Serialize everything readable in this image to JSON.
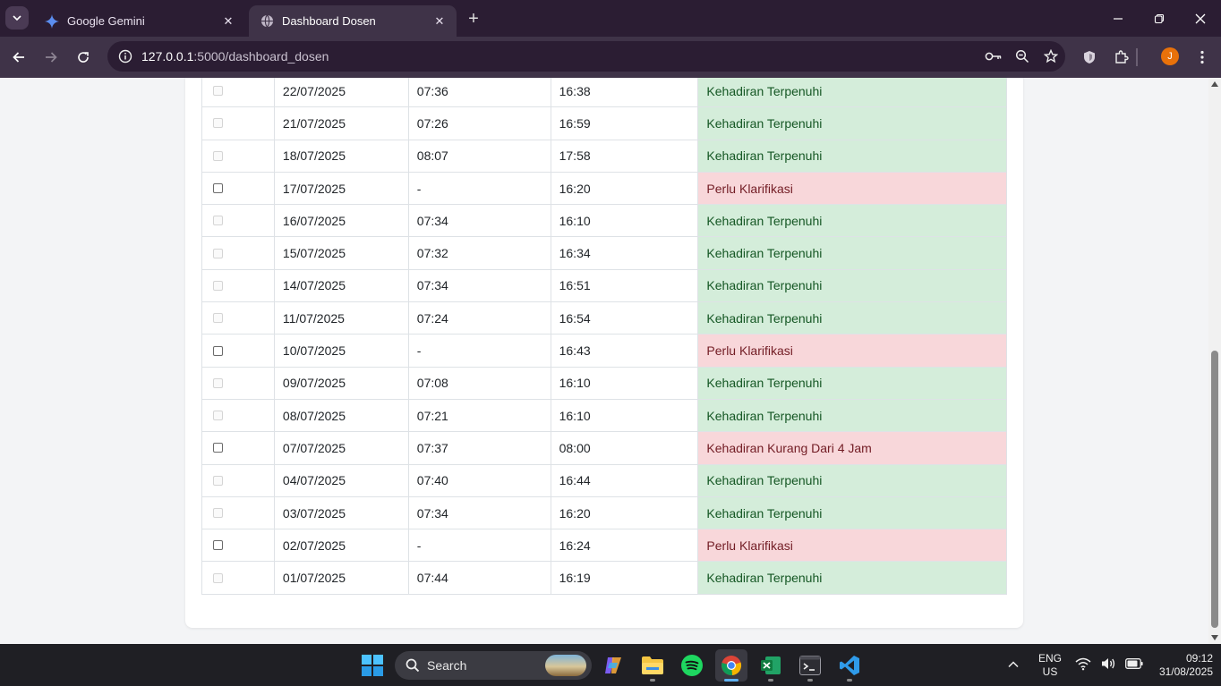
{
  "browser": {
    "tabs": [
      {
        "title": "Google Gemini",
        "icon": "gemini-icon",
        "active": false
      },
      {
        "title": "Dashboard Dosen",
        "icon": "globe-icon",
        "active": true
      }
    ],
    "url_host": "127.0.0.1",
    "url_path": ":5000/dashboard_dosen",
    "profile_initial": "J"
  },
  "attendance": {
    "rows": [
      {
        "date": "22/07/2025",
        "in": "07:36",
        "out": "16:38",
        "status": "Kehadiran Terpenuhi",
        "ok": true
      },
      {
        "date": "21/07/2025",
        "in": "07:26",
        "out": "16:59",
        "status": "Kehadiran Terpenuhi",
        "ok": true
      },
      {
        "date": "18/07/2025",
        "in": "08:07",
        "out": "17:58",
        "status": "Kehadiran Terpenuhi",
        "ok": true
      },
      {
        "date": "17/07/2025",
        "in": "-",
        "out": "16:20",
        "status": "Perlu Klarifikasi",
        "ok": false
      },
      {
        "date": "16/07/2025",
        "in": "07:34",
        "out": "16:10",
        "status": "Kehadiran Terpenuhi",
        "ok": true
      },
      {
        "date": "15/07/2025",
        "in": "07:32",
        "out": "16:34",
        "status": "Kehadiran Terpenuhi",
        "ok": true
      },
      {
        "date": "14/07/2025",
        "in": "07:34",
        "out": "16:51",
        "status": "Kehadiran Terpenuhi",
        "ok": true
      },
      {
        "date": "11/07/2025",
        "in": "07:24",
        "out": "16:54",
        "status": "Kehadiran Terpenuhi",
        "ok": true
      },
      {
        "date": "10/07/2025",
        "in": "-",
        "out": "16:43",
        "status": "Perlu Klarifikasi",
        "ok": false
      },
      {
        "date": "09/07/2025",
        "in": "07:08",
        "out": "16:10",
        "status": "Kehadiran Terpenuhi",
        "ok": true
      },
      {
        "date": "08/07/2025",
        "in": "07:21",
        "out": "16:10",
        "status": "Kehadiran Terpenuhi",
        "ok": true
      },
      {
        "date": "07/07/2025",
        "in": "07:37",
        "out": "08:00",
        "status": "Kehadiran Kurang Dari 4 Jam",
        "ok": false
      },
      {
        "date": "04/07/2025",
        "in": "07:40",
        "out": "16:44",
        "status": "Kehadiran Terpenuhi",
        "ok": true
      },
      {
        "date": "03/07/2025",
        "in": "07:34",
        "out": "16:20",
        "status": "Kehadiran Terpenuhi",
        "ok": true
      },
      {
        "date": "02/07/2025",
        "in": "-",
        "out": "16:24",
        "status": "Perlu Klarifikasi",
        "ok": false
      },
      {
        "date": "01/07/2025",
        "in": "07:44",
        "out": "16:19",
        "status": "Kehadiran Terpenuhi",
        "ok": true
      }
    ],
    "colors": {
      "ok_bg": "#d4edda",
      "ok_text": "#155724",
      "bad_bg": "#f8d7da",
      "bad_text": "#721c24"
    }
  },
  "taskbar": {
    "search_label": "Search",
    "language": "ENG",
    "region": "US",
    "time": "09:12",
    "date": "31/08/2025",
    "apps": [
      "windows-start-icon",
      "copilot-icon",
      "file-explorer-icon",
      "spotify-icon",
      "chrome-icon",
      "excel-icon",
      "terminal-icon",
      "vscode-icon"
    ]
  }
}
